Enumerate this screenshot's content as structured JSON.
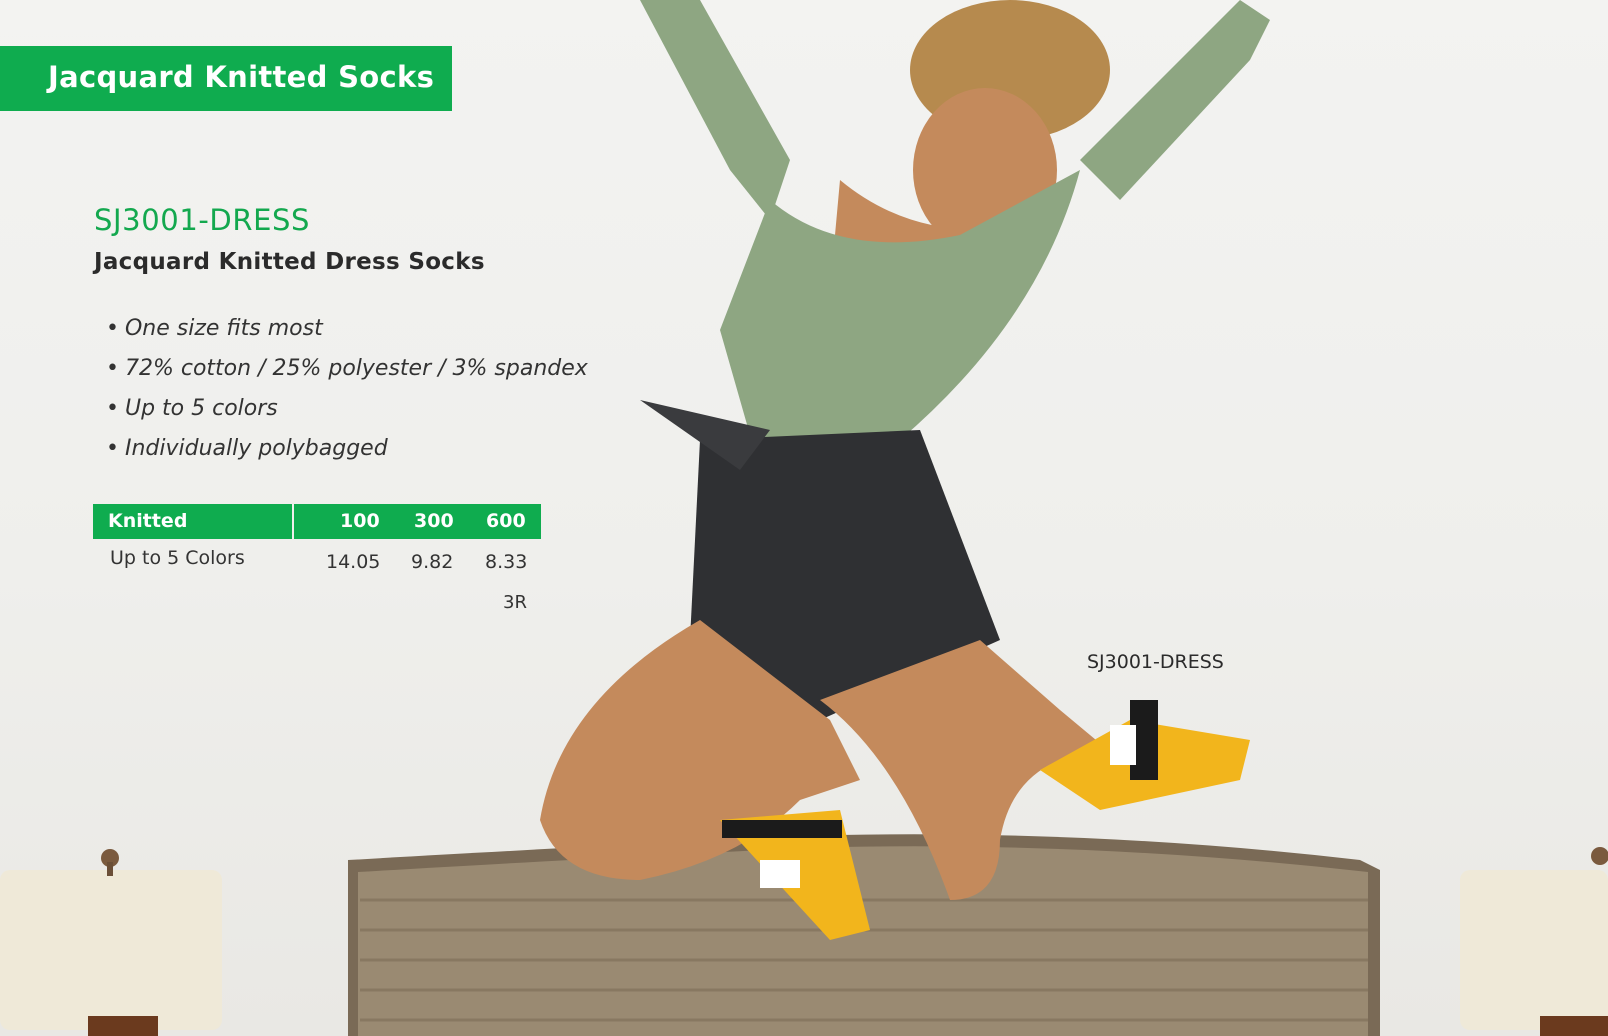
{
  "banner": {
    "title": "Jacquard Knitted Socks"
  },
  "product": {
    "code": "SJ3001-DRESS",
    "name": "Jacquard Knitted Dress Socks",
    "features": [
      "One size fits most",
      "72% cotton / 25% polyester / 3% spandex",
      "Up to 5 colors",
      "Individually polybagged"
    ]
  },
  "pricing": {
    "header_label": "Knitted",
    "quantities": [
      "100",
      "300",
      "600"
    ],
    "row_label": "Up to 5 Colors",
    "prices": [
      "14.05",
      "9.82",
      "8.33"
    ],
    "note": "3R"
  },
  "photo": {
    "caption": "SJ3001-DRESS"
  },
  "colors": {
    "brand_green": "#0fac4f",
    "sock_yellow": "#f2b51c",
    "top_green": "#8ea682"
  }
}
